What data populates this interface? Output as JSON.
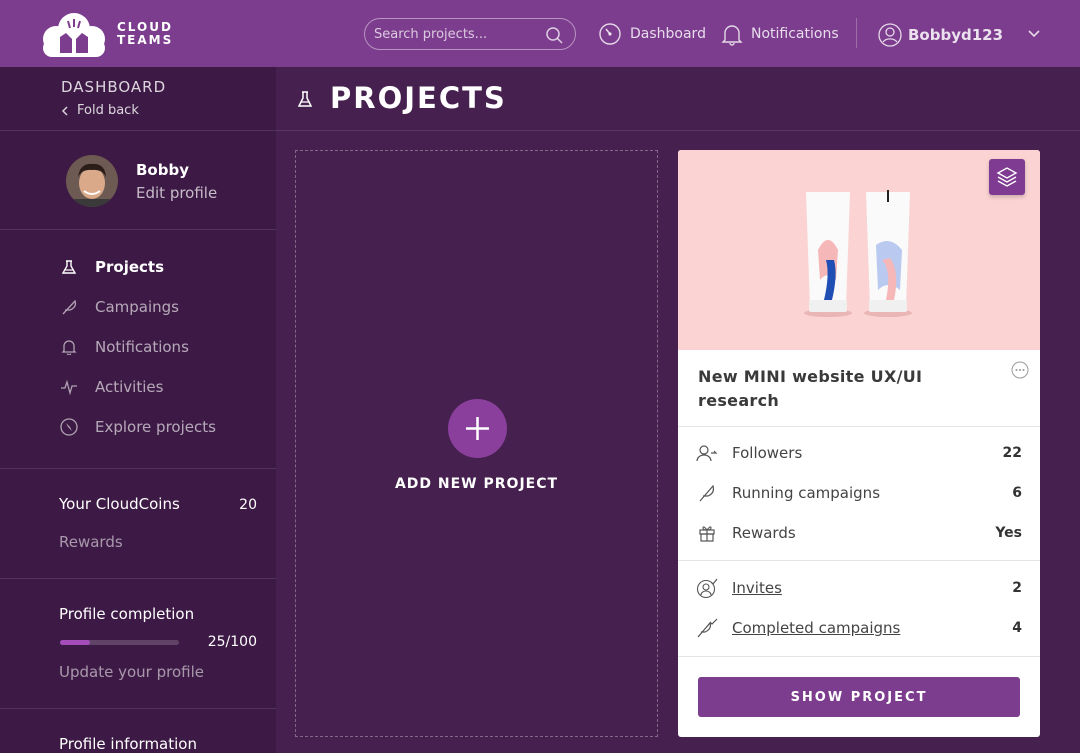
{
  "header": {
    "brand_line1": "CLOUD",
    "brand_line2": "TEAMS",
    "search_placeholder": "Search projects...",
    "nav_dashboard": "Dashboard",
    "nav_notifications": "Notifications",
    "username": "Bobbyd123"
  },
  "sidebar": {
    "title": "DASHBOARD",
    "fold_back": "Fold back",
    "profile_name": "Bobby",
    "edit_profile": "Edit profile",
    "menu": [
      {
        "label": "Projects",
        "icon": "flask-icon",
        "active": true
      },
      {
        "label": "Campaings",
        "icon": "feather-icon",
        "active": false
      },
      {
        "label": "Notifications",
        "icon": "bell-icon",
        "active": false
      },
      {
        "label": "Activities",
        "icon": "pulse-icon",
        "active": false
      },
      {
        "label": "Explore projects",
        "icon": "compass-icon",
        "active": false
      }
    ],
    "coins_label": "Your CloudCoins",
    "coins_value": "20",
    "rewards": "Rewards",
    "profile_completion_label": "Profile completion",
    "profile_completion_value": "25/100",
    "profile_completion_fraction": 0.25,
    "update_profile": "Update your profile",
    "profile_information": "Profile information"
  },
  "main": {
    "title": "PROJECTS",
    "add_project_label": "ADD NEW PROJECT"
  },
  "project_card": {
    "title": "New MINI website UX/UI research",
    "stats": [
      {
        "label": "Followers",
        "value": "22",
        "icon": "user-follow-icon"
      },
      {
        "label": "Running campaigns",
        "value": "6",
        "icon": "feather-icon"
      },
      {
        "label": "Rewards",
        "value": "Yes",
        "icon": "gift-icon"
      }
    ],
    "links": [
      {
        "label": "Invites",
        "value": "2",
        "icon": "user-check-icon"
      },
      {
        "label": "Completed campaigns",
        "value": "4",
        "icon": "feather-check-icon"
      }
    ],
    "show_button": "SHOW PROJECT"
  },
  "colors": {
    "header_bg": "#7d3d8e",
    "sidebar_bg": "#3d1a45",
    "main_bg": "#46204f",
    "accent": "#7d3d8e",
    "progress_fill": "#a44dbb",
    "card_image_bg": "#fbd3d3"
  }
}
